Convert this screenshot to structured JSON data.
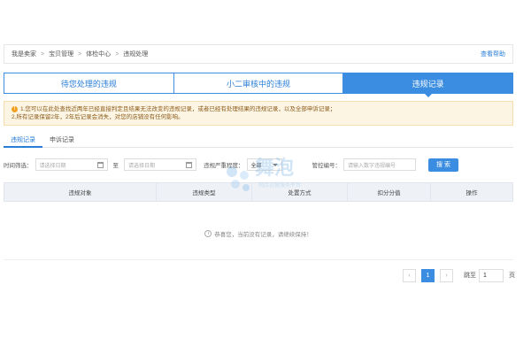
{
  "breadcrumb": {
    "items": [
      "我是卖家",
      "宝贝管理",
      "体检中心",
      "违规处理"
    ],
    "help_label": "查看帮助"
  },
  "main_tabs": [
    {
      "label": "待您处理的违规",
      "active": false
    },
    {
      "label": "小二审核中的违规",
      "active": false
    },
    {
      "label": "违规记录",
      "active": true
    }
  ],
  "notice": {
    "line1": "1.您可以在此处查找近两年已经直接判定且结果无法改变的违规记录，或者已经有处理结果的违规记录，以及全部申诉记录；",
    "line2": "2.所有记录保留2年，2年后记录会消失，对您的店铺没有任何影响。"
  },
  "sub_tabs": [
    {
      "label": "违规记录",
      "active": true
    },
    {
      "label": "申诉记录",
      "active": false
    }
  ],
  "filters": {
    "time_label": "时间筛选：",
    "start_placeholder": "请选择日期",
    "to_label": "至",
    "end_placeholder": "请选择日期",
    "severity_label": "违规严重程度：",
    "severity_value": "全部",
    "complaint_label": "管控编号：",
    "complaint_placeholder": "请输入数字违规编号",
    "search_label": "搜 索"
  },
  "table": {
    "columns": [
      "违规对象",
      "违规类型",
      "处置方式",
      "扣分分值",
      "操作"
    ],
    "empty_message": "恭喜您，当前没有记录，请继续保持！"
  },
  "pagination": {
    "prev": "‹",
    "current": "1",
    "next": "›",
    "goto_label": "跳至",
    "goto_value": "1",
    "page_label": "页"
  },
  "watermark": {
    "brand": "舞泡",
    "sub": "网店运营服务平台"
  },
  "colors": {
    "accent": "#3a8de0",
    "notice_bg": "#fdf5e4",
    "warn": "#f0a020"
  }
}
